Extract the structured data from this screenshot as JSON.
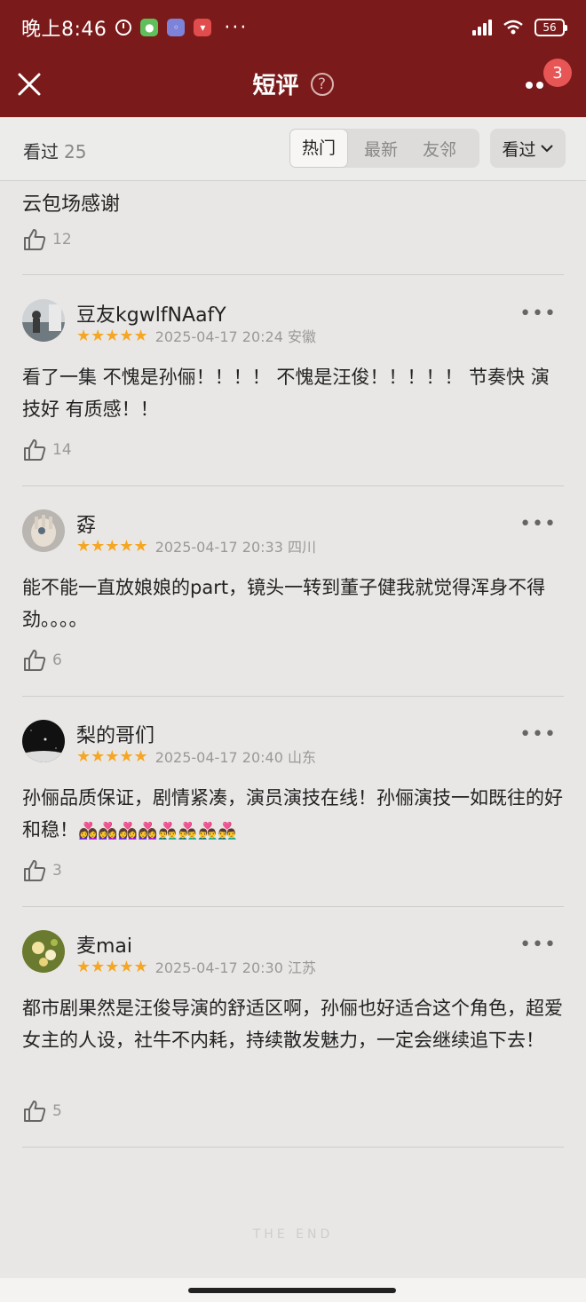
{
  "status_bar": {
    "time": "晚上8:46",
    "more": "···",
    "battery": "56"
  },
  "nav": {
    "title": "短评",
    "help": "?",
    "badge": "3"
  },
  "filter": {
    "seen_label": "看过",
    "seen_count": "25",
    "tabs": [
      "热门",
      "最新",
      "友邻"
    ],
    "dropdown": "看过"
  },
  "previous": {
    "text": "云包场感谢",
    "likes": "12"
  },
  "comments": [
    {
      "user": "豆友kgwlfNAafY",
      "stars": "★★★★★",
      "meta": "2025-04-17 20:24 安徽",
      "body": "看了一集 不愧是孙俪！！！！ 不愧是汪俊！！！！！ 节奏快 演技好 有质感！！",
      "likes": "14"
    },
    {
      "user": "孬",
      "stars": "★★★★★",
      "meta": "2025-04-17 20:33 四川",
      "body": "能不能一直放娘娘的part，镜头一转到董子健我就觉得浑身不得劲。。。。",
      "likes": "6"
    },
    {
      "user": "梨的哥们",
      "stars": "★★★★★",
      "meta": "2025-04-17 20:40 山东",
      "body": "孙俪品质保证，剧情紧凑，演员演技在线！孙俪演技一如既往的好和稳！",
      "emoji": "👩‍❤️‍👩👩‍❤️‍👩👩‍❤️‍👩👩‍❤️‍👩👨‍❤️‍👨👨‍❤️‍👨👨‍❤️‍👨👨‍❤️‍👨",
      "likes": "3"
    },
    {
      "user": "麦mai",
      "stars": "★★★★★",
      "meta": "2025-04-17 20:30 江苏",
      "body": "都市剧果然是汪俊导演的舒适区啊，孙俪也好适合这个角色，超爱女主的人设，社牛不内耗，持续散发魅力，一定会继续追下去！",
      "likes": "5"
    }
  ],
  "footer": {
    "the_end": "THE END"
  },
  "colors": {
    "header_bg": "#7b1a1a",
    "star": "#f5a623",
    "badge": "#e85555"
  }
}
